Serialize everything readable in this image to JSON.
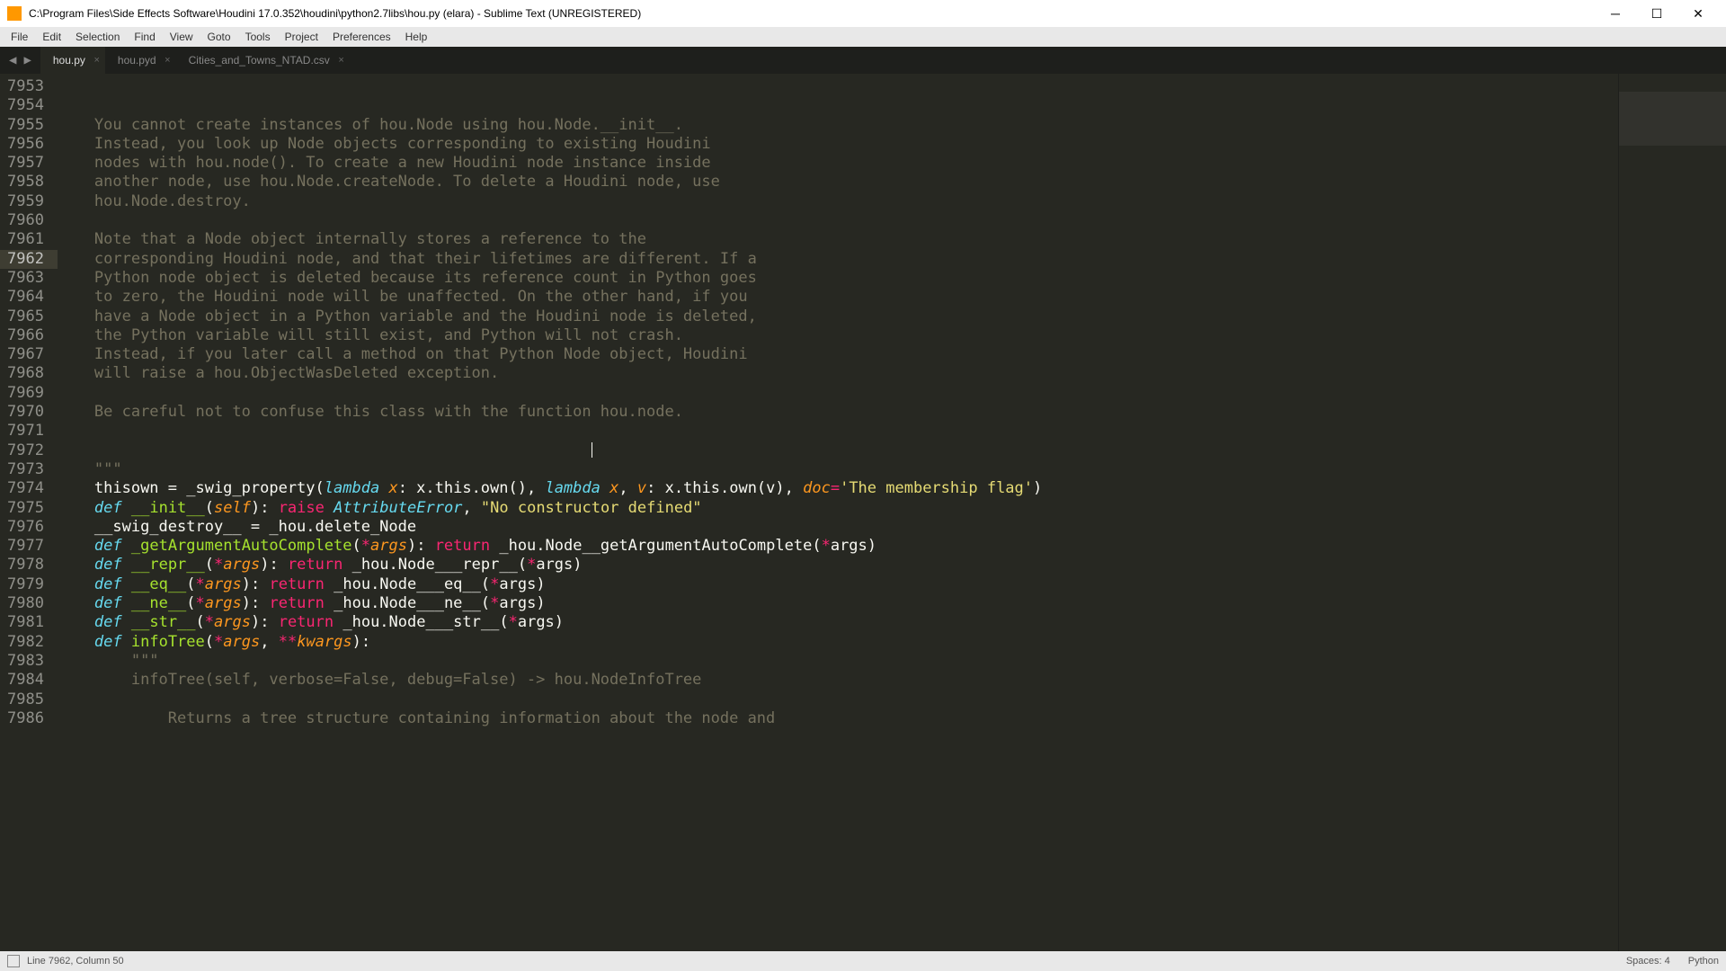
{
  "window": {
    "title": "C:\\Program Files\\Side Effects Software\\Houdini 17.0.352\\houdini\\python2.7libs\\hou.py (elara) - Sublime Text (UNREGISTERED)"
  },
  "menu": [
    "File",
    "Edit",
    "Selection",
    "Find",
    "View",
    "Goto",
    "Tools",
    "Project",
    "Preferences",
    "Help"
  ],
  "tabs": [
    {
      "label": "hou.py",
      "active": true
    },
    {
      "label": "hou.pyd",
      "active": false
    },
    {
      "label": "Cities_and_Towns_NTAD.csv",
      "active": false
    }
  ],
  "gutter": {
    "start": 7953,
    "end": 7986,
    "highlighted": 7962
  },
  "code_lines": [
    {
      "n": 7953,
      "t": ""
    },
    {
      "n": 7954,
      "t": ""
    },
    {
      "n": 7955,
      "t": "    You cannot create instances of hou.Node using hou.Node.__init__.",
      "cls": "c-comment"
    },
    {
      "n": 7956,
      "t": "    Instead, you look up Node objects corresponding to existing Houdini",
      "cls": "c-comment"
    },
    {
      "n": 7957,
      "t": "    nodes with hou.node(). To create a new Houdini node instance inside",
      "cls": "c-comment"
    },
    {
      "n": 7958,
      "t": "    another node, use hou.Node.createNode. To delete a Houdini node, use",
      "cls": "c-comment"
    },
    {
      "n": 7959,
      "t": "    hou.Node.destroy.",
      "cls": "c-comment"
    },
    {
      "n": 7960,
      "t": "",
      "cls": "c-comment"
    },
    {
      "n": 7961,
      "t": "    Note that a Node object internally stores a reference to the",
      "cls": "c-comment"
    },
    {
      "n": 7962,
      "t": "    corresponding Houdini node, and that their lifetimes are different. If a",
      "cls": "c-comment"
    },
    {
      "n": 7963,
      "t": "    Python node object is deleted because its reference count in Python goes",
      "cls": "c-comment"
    },
    {
      "n": 7964,
      "t": "    to zero, the Houdini node will be unaffected. On the other hand, if you",
      "cls": "c-comment"
    },
    {
      "n": 7965,
      "t": "    have a Node object in a Python variable and the Houdini node is deleted,",
      "cls": "c-comment"
    },
    {
      "n": 7966,
      "t": "    the Python variable will still exist, and Python will not crash.",
      "cls": "c-comment"
    },
    {
      "n": 7967,
      "t": "    Instead, if you later call a method on that Python Node object, Houdini",
      "cls": "c-comment"
    },
    {
      "n": 7968,
      "t": "    will raise a hou.ObjectWasDeleted exception.",
      "cls": "c-comment"
    },
    {
      "n": 7969,
      "t": "",
      "cls": "c-comment"
    },
    {
      "n": 7970,
      "t": "    Be careful not to confuse this class with the function hou.node.",
      "cls": "c-comment"
    },
    {
      "n": 7971,
      "t": "",
      "cls": "c-comment"
    },
    {
      "n": 7972,
      "t": "",
      "cls": "c-comment",
      "cursor": true
    },
    {
      "n": 7973,
      "t": "    \"\"\"",
      "cls": "c-comment"
    },
    {
      "n": 7974,
      "raw": "    thisown = _swig_property(<span class='c-func'>lambda</span> <span class='c-param'>x</span>: x.this.own(), <span class='c-func'>lambda</span> <span class='c-param'>x</span>, <span class='c-param'>v</span>: x.this.own(v), <span class='c-param'>doc</span><span class='c-op'>=</span><span class='c-string'>'The membership flag'</span>)"
    },
    {
      "n": 7975,
      "raw": "    <span class='c-func'>def</span> <span class='c-funcname'>__init__</span>(<span class='c-self'>self</span>): <span class='c-keyword'>raise</span> <span class='c-type'>AttributeError</span>, <span class='c-string'>\"No constructor defined\"</span>"
    },
    {
      "n": 7976,
      "raw": "    __swig_destroy__ = _hou.delete_Node"
    },
    {
      "n": 7977,
      "raw": "    <span class='c-func'>def</span> <span class='c-funcname'>_getArgumentAutoComplete</span>(<span class='c-op'>*</span><span class='c-param'>args</span>): <span class='c-keyword'>return</span> _hou.Node__getArgumentAutoComplete(<span class='c-op'>*</span>args)"
    },
    {
      "n": 7978,
      "raw": "    <span class='c-func'>def</span> <span class='c-funcname'>__repr__</span>(<span class='c-op'>*</span><span class='c-param'>args</span>): <span class='c-keyword'>return</span> _hou.Node___repr__(<span class='c-op'>*</span>args)"
    },
    {
      "n": 7979,
      "raw": "    <span class='c-func'>def</span> <span class='c-funcname'>__eq__</span>(<span class='c-op'>*</span><span class='c-param'>args</span>): <span class='c-keyword'>return</span> _hou.Node___eq__(<span class='c-op'>*</span>args)"
    },
    {
      "n": 7980,
      "raw": "    <span class='c-func'>def</span> <span class='c-funcname'>__ne__</span>(<span class='c-op'>*</span><span class='c-param'>args</span>): <span class='c-keyword'>return</span> _hou.Node___ne__(<span class='c-op'>*</span>args)"
    },
    {
      "n": 7981,
      "raw": "    <span class='c-func'>def</span> <span class='c-funcname'>__str__</span>(<span class='c-op'>*</span><span class='c-param'>args</span>): <span class='c-keyword'>return</span> _hou.Node___str__(<span class='c-op'>*</span>args)"
    },
    {
      "n": 7982,
      "raw": "    <span class='c-func'>def</span> <span class='c-funcname'>infoTree</span>(<span class='c-op'>*</span><span class='c-param'>args</span>, <span class='c-op'>**</span><span class='c-param'>kwargs</span>):"
    },
    {
      "n": 7983,
      "t": "        \"\"\"",
      "cls": "c-comment"
    },
    {
      "n": 7984,
      "t": "        infoTree(self, verbose=False, debug=False) -> hou.NodeInfoTree",
      "cls": "c-comment"
    },
    {
      "n": 7985,
      "t": "",
      "cls": "c-comment"
    },
    {
      "n": 7986,
      "t": "            Returns a tree structure containing information about the node and",
      "cls": "c-comment"
    }
  ],
  "status": {
    "position": "Line 7962, Column 50",
    "spaces": "Spaces: 4",
    "language": "Python"
  }
}
